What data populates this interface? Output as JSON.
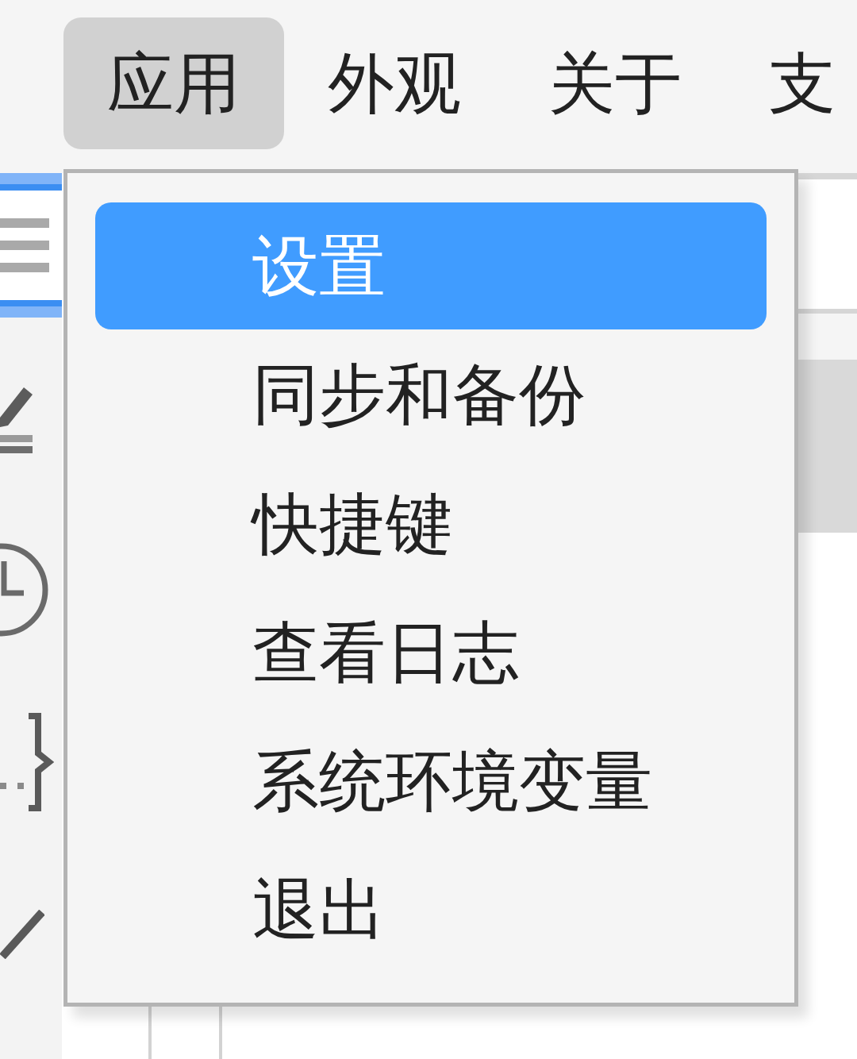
{
  "menubar": {
    "items": [
      {
        "label": "应用",
        "selected": true
      },
      {
        "label": "外观",
        "selected": false
      },
      {
        "label": "关于",
        "selected": false
      },
      {
        "label": "支",
        "selected": false
      }
    ]
  },
  "sidebar": {
    "items": [
      {
        "selected": true
      },
      {
        "selected": false
      },
      {
        "selected": false
      },
      {
        "selected": false
      },
      {
        "selected": false
      }
    ]
  },
  "dropdown": {
    "items": [
      {
        "label": "设置",
        "selected": true
      },
      {
        "label": "同步和备份",
        "selected": false
      },
      {
        "label": "快捷键",
        "selected": false
      },
      {
        "label": "查看日志",
        "selected": false
      },
      {
        "label": "系统环境变量",
        "selected": false
      },
      {
        "label": "退出",
        "selected": false
      }
    ]
  }
}
